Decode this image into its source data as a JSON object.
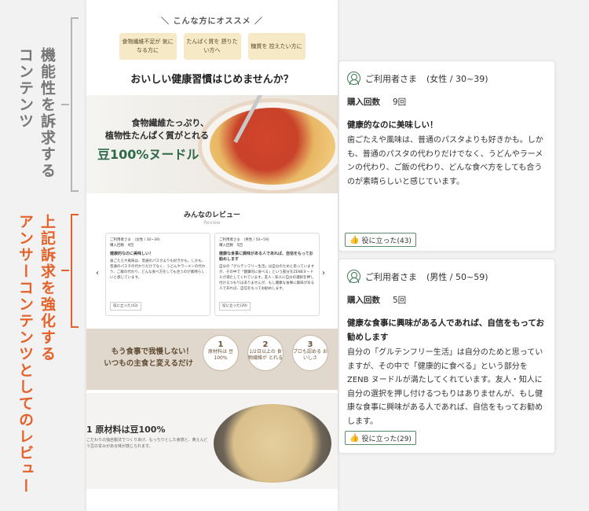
{
  "annotations": {
    "functional": [
      "機能性を",
      "訴求する",
      "コンテンツ"
    ],
    "review": [
      "上記訴求を強化する",
      "アンサーコンテンツとしてのレビュー"
    ]
  },
  "phone": {
    "recommend_title": "＼ こんな方にオススメ ／",
    "chips": [
      "食物繊維不足が 気になる方に",
      "たんぱく質を 摂りたい方へ",
      "糖質を 控えたい方に"
    ],
    "headline": "おいしい健康習慣はじめませんか？",
    "hero": {
      "copy_line1": "食物繊維たっぷり、",
      "copy_line2": "植物性たんぱく質がとれる",
      "brand": "豆100%ヌードル"
    },
    "review_section": {
      "title": "みんなのレビュー",
      "subtitle": "Review"
    },
    "mini_reviews": [
      {
        "user": "ご利用者さま　(女性 / 30~39)",
        "count": "購入回数　9回",
        "title": "健康的なのに美味しい！",
        "body": "歯ごたえや風味は、普通のパスタよりも好きかも。しかも、普通のパスタの代わりだけでなく、うどんやラーメンの代わり、ご飯の代わり、どんな食べ方をしても合うのが素晴らしいと感じています。",
        "helpful": "役に立った(43)"
      },
      {
        "user": "ご利用者さま　(男性 / 50~59)",
        "count": "購入回数　5回",
        "title": "健康な食事に興味がある人であれば、自信をもってお勧めします",
        "body": "自分の「グルテンフリー生活」は自分のためと思っていますが、その中で「健康的に食べる」という部分をZENBヌードルが満たしてくれています。友人・知人に自分の選択を押し付けるつもりはありませんが、もし健康な食事に興味がある人であれば、自信をもってお勧めします。",
        "helpful": "役に立った(29)"
      }
    ],
    "banner": {
      "line1": "もう食事で我慢しない！",
      "line2": "いつもの主食と変えるだけ",
      "points": [
        {
          "num": "1",
          "text": "原材料は 豆100%"
        },
        {
          "num": "2",
          "text": "1/2日以上の 食物繊維が とれる"
        },
        {
          "num": "3",
          "text": "プロも認める おいしさ"
        }
      ]
    },
    "feature": {
      "title": "1  原材料は豆100%",
      "text": "こだわりの独自製法でつくりあげ、もっちりとした食感と、黄えんどう豆の甘みがある味が感じられます。"
    }
  },
  "reviews": [
    {
      "user": "ご利用者さま",
      "attributes": "(女性 / 30~39)",
      "purchase_label": "購入回数",
      "purchase_count": "9回",
      "title": "健康的なのに美味しい！",
      "body": "歯ごたえや風味は、普通のパスタよりも好きかも。しかも、普通のパスタの代わりだけでなく、うどんやラーメンの代わり、ご飯の代わり、どんな食べ方をしても合うのが素晴らしいと感じています。",
      "helpful": "役に立った(43)"
    },
    {
      "user": "ご利用者さま",
      "attributes": "(男性 / 50~59)",
      "purchase_label": "購入回数",
      "purchase_count": "5回",
      "title": "健康な食事に興味がある人であれば、自信をもってお勧めします",
      "body": "自分の「グルテンフリー生活」は自分のためと思っていますが、その中で「健康的に食べる」という部分をZENB ヌードルが満たしてくれています。友人・知人に自分の選択を押し付けるつもりはありませんが、もし健康な食事に興味がある人であれば、自信をもってお勧めします。",
      "helpful": "役に立った(29)"
    }
  ],
  "colors": {
    "accent_orange": "#e4612a",
    "green": "#3f7a55",
    "chip_bg": "#f5e9c6"
  }
}
